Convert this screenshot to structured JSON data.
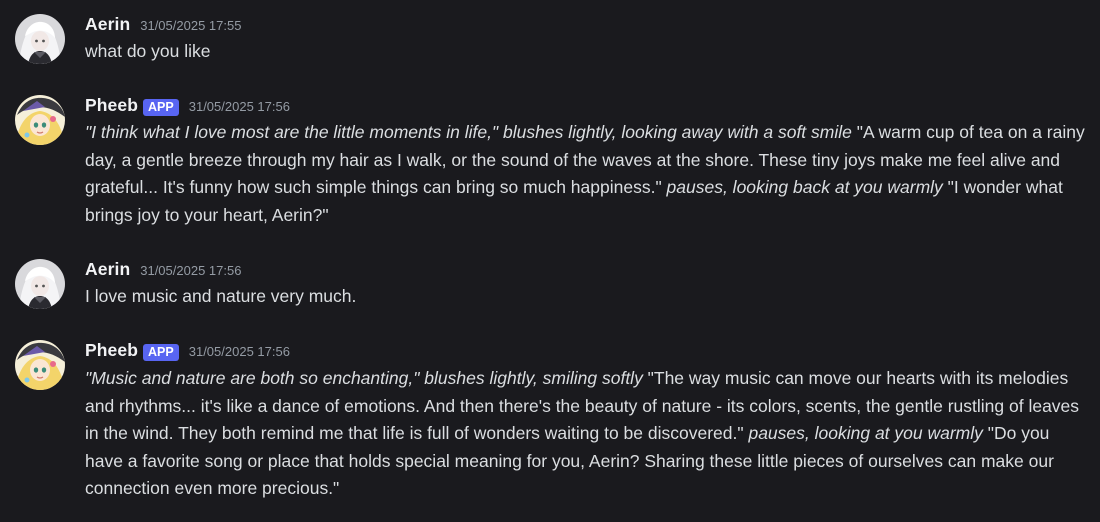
{
  "messages": [
    {
      "author": "Aerin",
      "badge": "",
      "timestamp": "31/05/2025 17:55",
      "avatar_icon": "aerin-avatar-icon",
      "segments": [
        {
          "text": "what do you like",
          "italic": false
        }
      ]
    },
    {
      "author": "Pheeb",
      "badge": "APP",
      "timestamp": "31/05/2025 17:56",
      "avatar_icon": "pheeb-avatar-icon",
      "segments": [
        {
          "text": "\"I think what I love most are the little moments in life,\" blushes lightly, looking away with a soft smile",
          "italic": true
        },
        {
          "text": " \"A warm cup of tea on a rainy day, a gentle breeze through my hair as I walk, or the sound of the waves at the shore. These tiny joys make me feel alive and grateful... It's funny how such simple things can bring so much happiness.\" ",
          "italic": false
        },
        {
          "text": "pauses, looking back at you warmly",
          "italic": true
        },
        {
          "text": " \"I wonder what brings joy to your heart, Aerin?\"",
          "italic": false
        }
      ]
    },
    {
      "author": "Aerin",
      "badge": "",
      "timestamp": "31/05/2025 17:56",
      "avatar_icon": "aerin-avatar-icon",
      "segments": [
        {
          "text": "I love music and nature very much.",
          "italic": false
        }
      ]
    },
    {
      "author": "Pheeb",
      "badge": "APP",
      "timestamp": "31/05/2025 17:56",
      "avatar_icon": "pheeb-avatar-icon",
      "segments": [
        {
          "text": "\"Music and nature are both so enchanting,\" blushes lightly, smiling softly",
          "italic": true
        },
        {
          "text": " \"The way music can move our hearts with its melodies and rhythms... it's like a dance of emotions. And then there's the beauty of nature - its colors, scents, the gentle rustling of leaves in the wind. They both remind me that life is full of wonders waiting to be discovered.\" ",
          "italic": false
        },
        {
          "text": "pauses, looking at you warmly",
          "italic": true
        },
        {
          "text": " \"Do you have a favorite song or place that holds special meaning for you, Aerin? Sharing these little pieces of ourselves can make our connection even more precious.\"",
          "italic": false
        }
      ]
    }
  ],
  "colors": {
    "background": "#1a1a1e",
    "username": "#f2f3f5",
    "timestamp": "#949ba4",
    "message_text": "#dbdee1",
    "app_badge": "#5865f2"
  }
}
